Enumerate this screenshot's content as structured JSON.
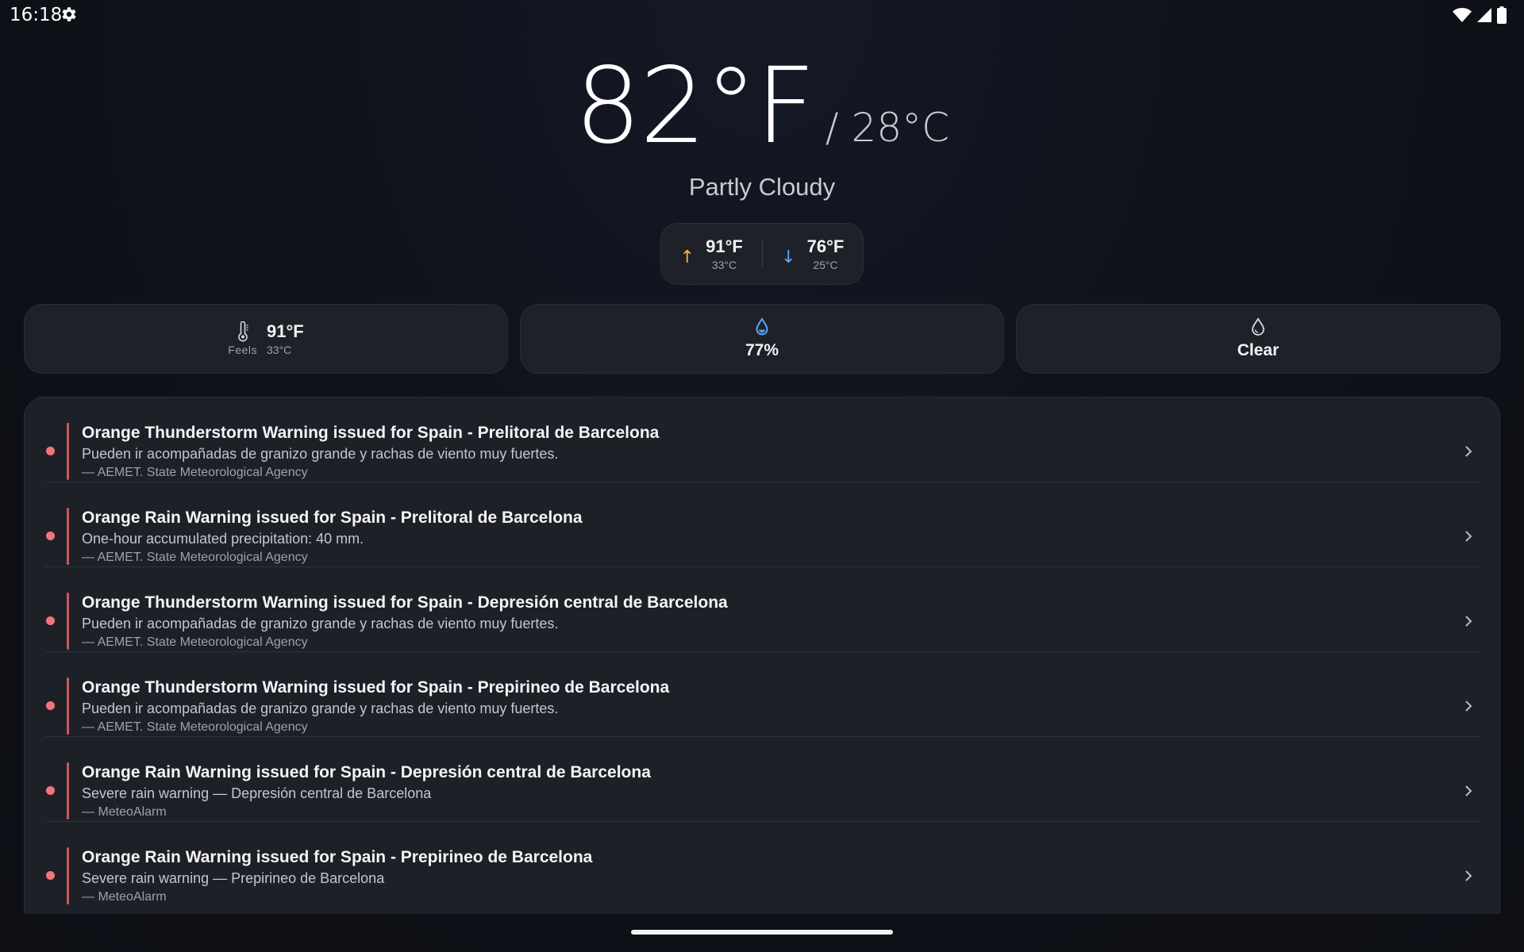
{
  "status_bar": {
    "time": "16:18",
    "icons": [
      "gear-icon",
      "wifi-icon",
      "signal-icon",
      "battery-icon"
    ]
  },
  "current": {
    "temp_f": "82°F",
    "temp_c": "/ 28°C",
    "condition": "Partly Cloudy"
  },
  "hilo": {
    "high_f": "91°F",
    "high_c": "33°C",
    "low_f": "76°F",
    "low_c": "25°C",
    "high_arrow": "↑",
    "low_arrow": "↓"
  },
  "cards": {
    "feels": {
      "label": "Feels",
      "value_f": "91°F",
      "value_c": "33°C",
      "icon": "thermometer-icon"
    },
    "humidity": {
      "value": "77%",
      "icon": "humidity-drop-icon",
      "color": "#5aa6f5"
    },
    "precip": {
      "value": "Clear",
      "icon": "drop-outline-icon"
    }
  },
  "alerts": [
    {
      "title": "Orange Thunderstorm Warning issued for Spain - Prelitoral de Barcelona",
      "description": "Pueden ir acompañadas de granizo grande y rachas de viento muy fuertes.",
      "source": "— AEMET. State Meteorological Agency"
    },
    {
      "title": "Orange Rain Warning issued for Spain - Prelitoral de Barcelona",
      "description": "One-hour accumulated precipitation: 40 mm.",
      "source": "— AEMET. State Meteorological Agency"
    },
    {
      "title": "Orange Thunderstorm Warning issued for Spain - Depresión central de Barcelona",
      "description": "Pueden ir acompañadas de granizo grande y rachas de viento muy fuertes.",
      "source": "— AEMET. State Meteorological Agency"
    },
    {
      "title": "Orange Thunderstorm Warning issued for Spain - Prepirineo de Barcelona",
      "description": "Pueden ir acompañadas de granizo grande y rachas de viento muy fuertes.",
      "source": "— AEMET. State Meteorological Agency"
    },
    {
      "title": "Orange Rain Warning issued for Spain - Depresión central de Barcelona",
      "description": "Severe rain warning — Depresión central de Barcelona",
      "source": "— MeteoAlarm"
    },
    {
      "title": "Orange Rain Warning issued for Spain - Prepirineo de Barcelona",
      "description": "Severe rain warning — Prepirineo de Barcelona",
      "source": "— MeteoAlarm"
    }
  ],
  "colors": {
    "background": "#0f1118",
    "card": "#1f2129",
    "alert_dot": "#f0767a",
    "alert_bar": "#c45b60",
    "high_arrow": "#f0b34a",
    "low_arrow": "#5aa6f5"
  }
}
